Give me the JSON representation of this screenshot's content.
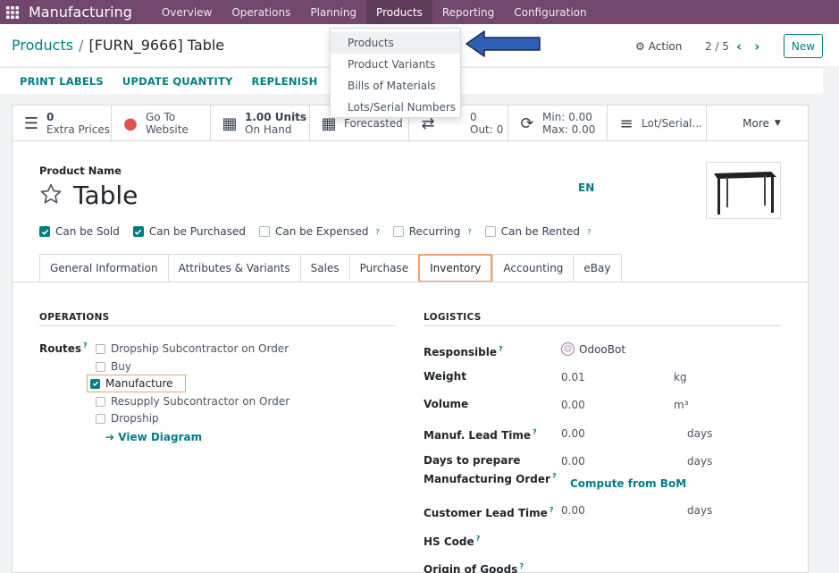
{
  "navbar": {
    "brand": "Manufacturing",
    "menu": [
      "Overview",
      "Operations",
      "Planning",
      "Products",
      "Reporting",
      "Configuration"
    ],
    "active": "Products",
    "bg_color": "#71476b"
  },
  "dropdown": {
    "items": [
      "Products",
      "Product Variants",
      "Bills of Materials",
      "Lots/Serial Numbers"
    ],
    "highlighted": "Products"
  },
  "breadcrumb": {
    "parent": "Products",
    "separator": "/",
    "current": "[FURN_9666] Table"
  },
  "control": {
    "action_label": "Action",
    "pager": "2 / 5",
    "new_label": "New"
  },
  "action_bar": [
    "PRINT LABELS",
    "UPDATE QUANTITY",
    "REPLENISH"
  ],
  "smart_buttons": [
    {
      "icon": "list-icon",
      "value": "0",
      "label": "Extra Prices"
    },
    {
      "icon": "globe-icon",
      "value": "Go To",
      "label": "Website"
    },
    {
      "icon": "cubes-icon",
      "value": "1.00 Units",
      "label": "On Hand"
    },
    {
      "icon": "cubes-icon",
      "value": "",
      "label": "Forecasted"
    },
    {
      "icon": "exchange-icon",
      "value": "0",
      "label": "Out:  0"
    },
    {
      "icon": "refresh-icon",
      "value": "Min:  0.00",
      "label": "Max:  0.00"
    },
    {
      "icon": "bars-icon",
      "value": "",
      "label": "Lot/Serial..."
    }
  ],
  "more_label": "More",
  "product": {
    "name_label": "Product Name",
    "name": "Table",
    "lang": "EN"
  },
  "flags": [
    {
      "label": "Can be Sold",
      "checked": true,
      "help": false
    },
    {
      "label": "Can be Purchased",
      "checked": true,
      "help": false
    },
    {
      "label": "Can be Expensed",
      "checked": false,
      "help": true
    },
    {
      "label": "Recurring",
      "checked": false,
      "help": true
    },
    {
      "label": "Can be Rented",
      "checked": false,
      "help": true
    }
  ],
  "tabs": [
    "General Information",
    "Attributes & Variants",
    "Sales",
    "Purchase",
    "Inventory",
    "Accounting",
    "eBay"
  ],
  "active_tab": "Inventory",
  "operations": {
    "title": "OPERATIONS",
    "routes_label": "Routes",
    "routes": [
      {
        "label": "Dropship Subcontractor on Order",
        "checked": false
      },
      {
        "label": "Buy",
        "checked": false
      },
      {
        "label": "Manufacture",
        "checked": true
      },
      {
        "label": "Resupply Subcontractor on Order",
        "checked": false
      },
      {
        "label": "Dropship",
        "checked": false
      }
    ],
    "view_diagram": "View Diagram"
  },
  "logistics": {
    "title": "LOGISTICS",
    "responsible_label": "Responsible",
    "responsible": "OdooBot",
    "weight_label": "Weight",
    "weight": "0.01",
    "weight_unit": "kg",
    "volume_label": "Volume",
    "volume": "0.00",
    "volume_unit": "m³",
    "manuf_lead_label": "Manuf. Lead Time",
    "manuf_lead": "0.00",
    "days_prepare_label_1": "Days to prepare",
    "days_prepare_label_2": "Manufacturing Order",
    "days_prepare": "0.00",
    "compute_label": "Compute from BoM",
    "customer_lead_label": "Customer Lead Time",
    "customer_lead": "0.00",
    "days_unit": "days",
    "hs_code_label": "HS Code",
    "origin_label": "Origin of Goods"
  }
}
